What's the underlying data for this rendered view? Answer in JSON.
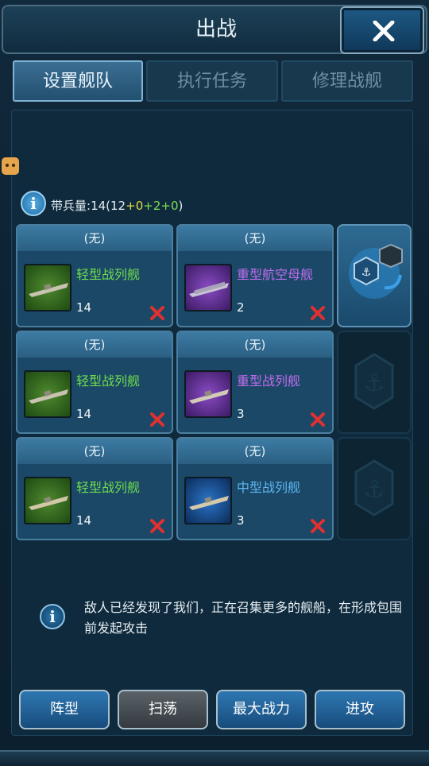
{
  "header": {
    "title": "出战",
    "close_icon": "close-icon"
  },
  "tabs": [
    {
      "label": "设置舰队",
      "active": true
    },
    {
      "label": "执行任务",
      "active": false
    },
    {
      "label": "修理战舰",
      "active": false
    }
  ],
  "troops": {
    "label": "带兵量:",
    "total": "14",
    "open": "(",
    "base": "12",
    "plus1": "+",
    "bonus1": "0",
    "plus2": "+",
    "bonus2": "2",
    "plus3": "+",
    "bonus3": "0",
    "close": ")"
  },
  "fleet": [
    {
      "header": "(无)",
      "name": "轻型战列舰",
      "count": "14",
      "tier": "green"
    },
    {
      "header": "(无)",
      "name": "重型航空母舰",
      "count": "2",
      "tier": "purple"
    },
    {
      "header": "(无)",
      "name": "轻型战列舰",
      "count": "14",
      "tier": "green"
    },
    {
      "header": "(无)",
      "name": "重型战列舰",
      "count": "3",
      "tier": "purple"
    },
    {
      "header": "(无)",
      "name": "轻型战列舰",
      "count": "14",
      "tier": "green"
    },
    {
      "header": "(无)",
      "name": "中型战列舰",
      "count": "3",
      "tier": "blue"
    }
  ],
  "message": "敌人已经发现了我们，正在召集更多的舰船，在形成包围前发起攻击",
  "buttons": {
    "formation": "阵型",
    "sweep": "扫荡",
    "max_power": "最大战力",
    "attack": "进攻"
  },
  "colors": {
    "green_tier": "#6fdc4e",
    "purple_tier": "#c06cf0",
    "blue_tier": "#5cb6f2",
    "remove": "#e03030"
  }
}
